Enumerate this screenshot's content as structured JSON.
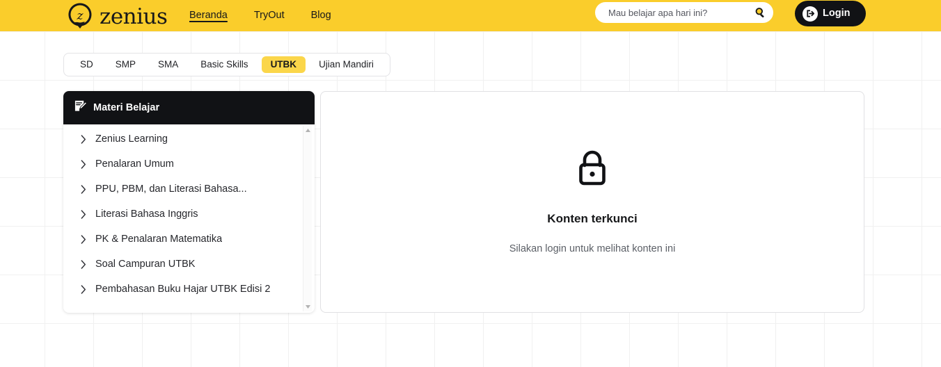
{
  "header": {
    "logo_text": "zenius",
    "logo_icon": "zenius-pin-logo",
    "nav": [
      {
        "label": "Beranda",
        "active": true
      },
      {
        "label": "TryOut",
        "active": false
      },
      {
        "label": "Blog",
        "active": false
      }
    ],
    "search": {
      "placeholder": "Mau belajar apa hari ini?",
      "value": "",
      "icon": "search-icon"
    },
    "login": {
      "label": "Login",
      "icon": "sign-in-icon"
    },
    "bg_color": "#facd2b"
  },
  "tabs": [
    {
      "label": "SD",
      "active": false
    },
    {
      "label": "SMP",
      "active": false
    },
    {
      "label": "SMA",
      "active": false
    },
    {
      "label": "Basic Skills",
      "active": false
    },
    {
      "label": "UTBK",
      "active": true
    },
    {
      "label": "Ujian Mandiri",
      "active": false
    }
  ],
  "sidebar": {
    "title": "Materi Belajar",
    "title_icon": "note-edit-icon",
    "header_bg": "#111215",
    "items": [
      {
        "label": "Zenius Learning"
      },
      {
        "label": "Penalaran Umum"
      },
      {
        "label": "PPU, PBM, dan Literasi Bahasa..."
      },
      {
        "label": "Literasi Bahasa Inggris"
      },
      {
        "label": "PK & Penalaran Matematika"
      },
      {
        "label": "Soal Campuran UTBK"
      },
      {
        "label": "Pembahasan Buku Hajar UTBK Edisi 2"
      }
    ],
    "scrollbar": {
      "up_icon": "scroll-up-arrow-icon",
      "down_icon": "scroll-down-arrow-icon"
    }
  },
  "main": {
    "lock_icon": "padlock-locked-icon",
    "title": "Konten terkunci",
    "subtitle": "Silakan login untuk melihat konten ini"
  }
}
